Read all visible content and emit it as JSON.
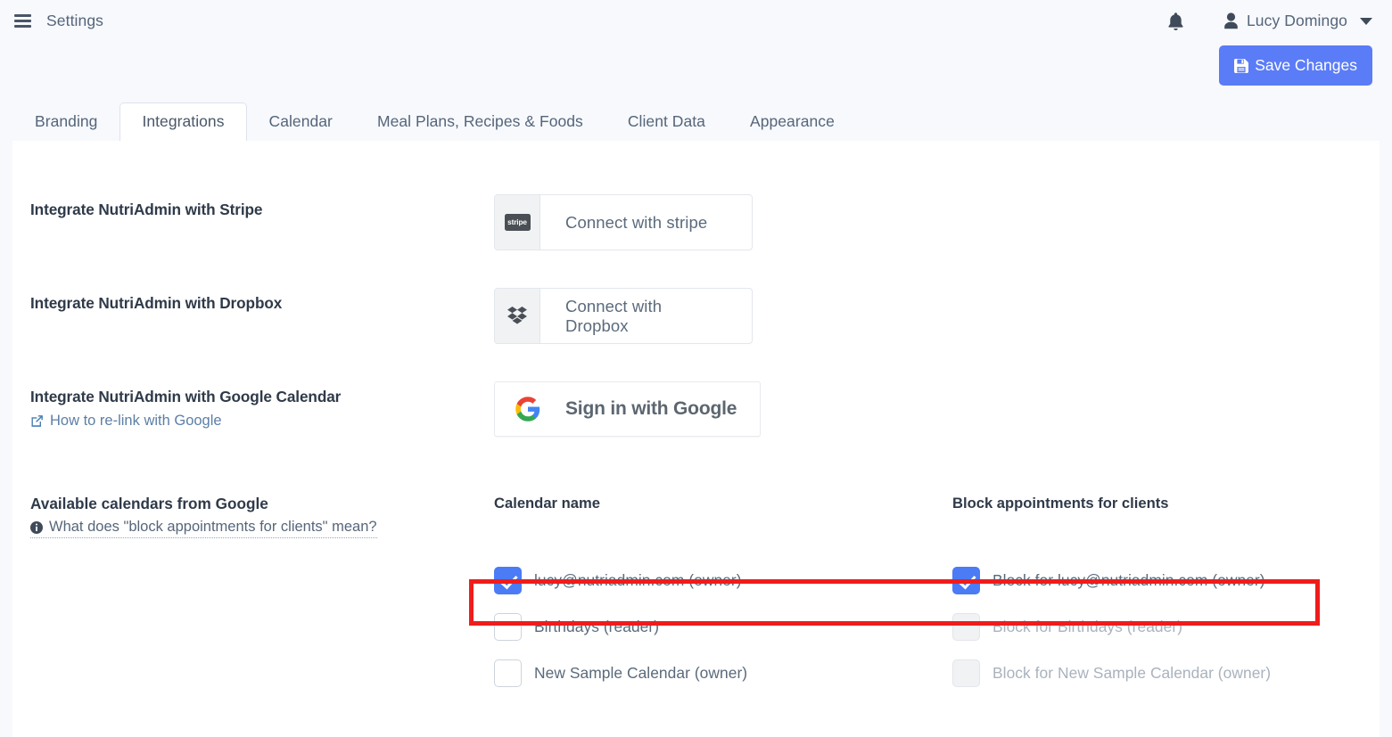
{
  "header": {
    "menu_icon": "hamburger-icon",
    "title": "Settings",
    "bell_icon": "notification-bell-icon",
    "user_icon": "user-avatar-icon",
    "user_name": "Lucy Domingo",
    "caret_icon": "chevron-down-icon"
  },
  "toolbar": {
    "save_label": "Save Changes",
    "save_icon": "save-disk-icon",
    "save_color": "#5b7cf7"
  },
  "tabs": [
    {
      "label": "Branding",
      "active": false
    },
    {
      "label": "Integrations",
      "active": true
    },
    {
      "label": "Calendar",
      "active": false
    },
    {
      "label": "Meal Plans, Recipes & Foods",
      "active": false
    },
    {
      "label": "Client Data",
      "active": false
    },
    {
      "label": "Appearance",
      "active": false
    }
  ],
  "integrations": [
    {
      "title": "Integrate NutriAdmin with Stripe",
      "button_label": "Connect with stripe",
      "icon": "stripe-logo-icon",
      "icon_text": "stripe"
    },
    {
      "title": "Integrate NutriAdmin with Dropbox",
      "button_label": "Connect with Dropbox",
      "icon": "dropbox-logo-icon"
    },
    {
      "title": "Integrate NutriAdmin with Google Calendar",
      "sublink": "How to re-link with Google",
      "sublink_icon": "external-link-icon",
      "button_label": "Sign in with Google",
      "icon": "google-logo-icon"
    }
  ],
  "calendars": {
    "section_title": "Available calendars from Google",
    "help_text": "What does \"block appointments for clients\" mean?",
    "help_icon": "info-circle-icon",
    "col_name_header": "Calendar name",
    "col_block_header": "Block appointments for clients",
    "rows": [
      {
        "name_label": "lucy@nutriadmin.com (owner)",
        "name_checked": true,
        "name_disabled": false,
        "block_label": "Block for lucy@nutriadmin.com (owner)",
        "block_checked": true,
        "block_disabled": false,
        "highlighted": true
      },
      {
        "name_label": "Birthdays (reader)",
        "name_checked": false,
        "name_disabled": false,
        "block_label": "Block for Birthdays (reader)",
        "block_checked": false,
        "block_disabled": true,
        "highlighted": false
      },
      {
        "name_label": "New Sample Calendar (owner)",
        "name_checked": false,
        "name_disabled": false,
        "block_label": "Block for New Sample Calendar (owner)",
        "block_checked": false,
        "block_disabled": true,
        "highlighted": false
      }
    ],
    "highlight_color": "#f01c1c"
  }
}
